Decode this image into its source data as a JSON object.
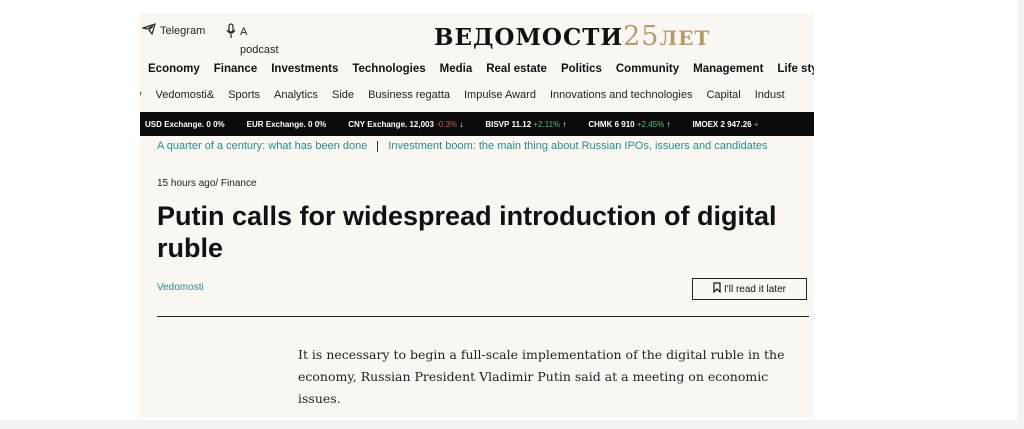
{
  "header": {
    "telegram_label": "Telegram",
    "podcast_label_line1": "A",
    "podcast_label_line2": "podcast",
    "logo_main": "ВЕДОМОСТИ",
    "logo_years": "25",
    "logo_suffix": "ЛЕТ"
  },
  "nav_primary": [
    "Economy",
    "Finance",
    "Investments",
    "Technologies",
    "Media",
    "Real estate",
    "Politics",
    "Community",
    "Management",
    "Life style"
  ],
  "nav_secondary": [
    "y",
    "Vedomosti&",
    "Sports",
    "Analytics",
    "Side",
    "Business regatta",
    "Impulse Award",
    "Innovations and technologies",
    "Capital",
    "Indust"
  ],
  "ticker": [
    {
      "name": "USD Exchange.",
      "value": "0",
      "change": "0%",
      "dir": ""
    },
    {
      "name": "EUR Exchange.",
      "value": "0",
      "change": "0%",
      "dir": ""
    },
    {
      "name": "CNY Exchange.",
      "value": "12,003",
      "change": "-0.3%",
      "dir": "↓"
    },
    {
      "name": "BISVP",
      "value": "11.12",
      "change": "+2.11%",
      "dir": "↑"
    },
    {
      "name": "CHMK",
      "value": "6 910",
      "change": "+2.45%",
      "dir": "↑"
    },
    {
      "name": "IMOEX",
      "value": "2 947.26",
      "change": "+",
      "dir": ""
    }
  ],
  "special_links": {
    "link1": "A quarter of a century: what has been done",
    "link2": "Investment boom: the main thing about Russian IPOs, issuers and candidates"
  },
  "article": {
    "meta": "15 hours ago/ Finance",
    "headline": "Putin calls for widespread introduction of digital ruble",
    "author": "Vedomosti",
    "read_later": "I'll read it later",
    "lead": "It is necessary to begin a full-scale implementation of the digital ruble in the economy, Russian President Vladimir Putin said at a meeting on economic issues."
  },
  "colors": {
    "accent_link": "#2a8a8a",
    "logo_gold": "#b59b6c",
    "ticker_bg": "#0b0b0b",
    "page_bg": "#faf7f3"
  },
  "icons": [
    "telegram-icon",
    "microphone-icon",
    "bookmark-icon"
  ]
}
